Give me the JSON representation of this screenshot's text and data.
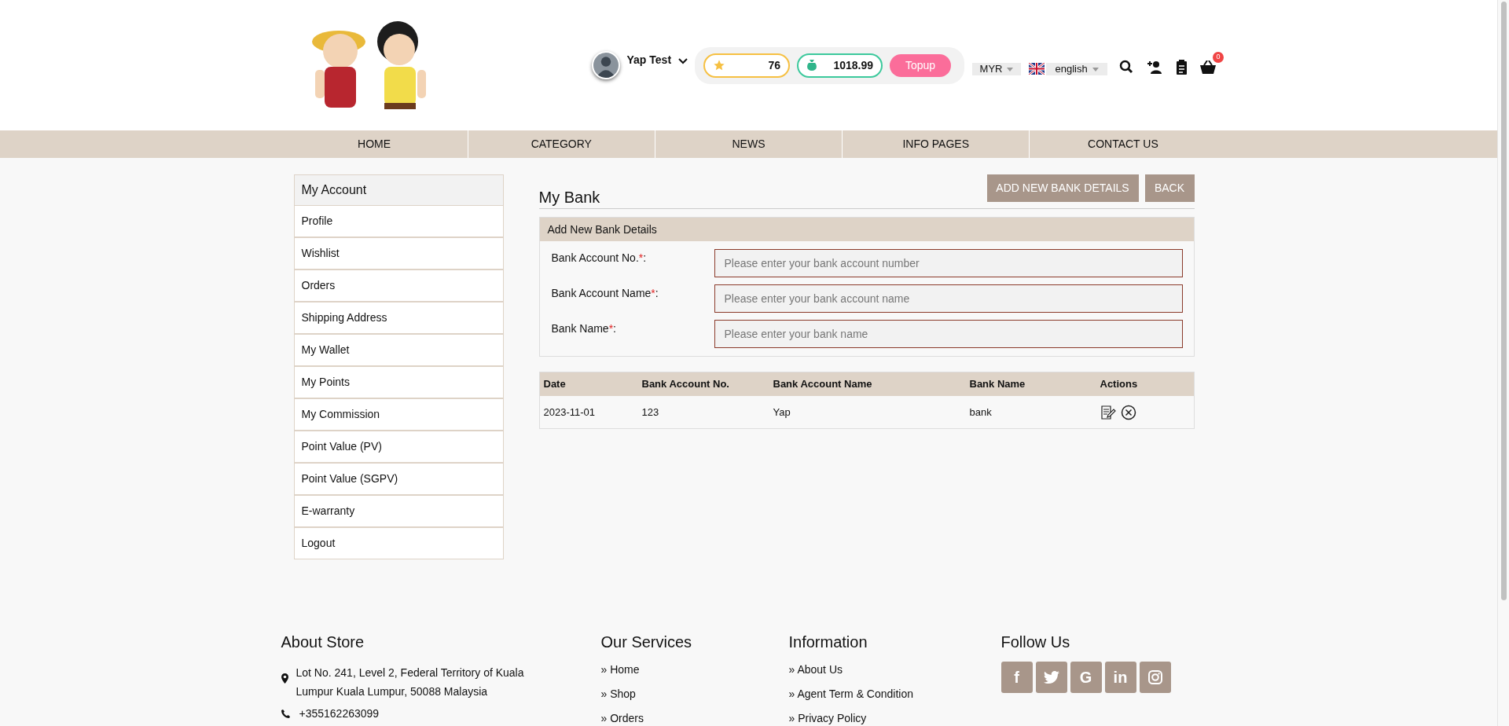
{
  "header": {
    "user_name": "Yap Test",
    "points": "76",
    "wallet": "1018.99",
    "topup_button": "Topup",
    "currency": "MYR",
    "language": "english",
    "cart_count": "0"
  },
  "nav": [
    {
      "label": "HOME"
    },
    {
      "label": "CATEGORY"
    },
    {
      "label": "NEWS"
    },
    {
      "label": "INFO PAGES"
    },
    {
      "label": "CONTACT US"
    }
  ],
  "sidebar": {
    "title": "My Account",
    "items": [
      "Profile",
      "Wishlist",
      "Orders",
      "Shipping Address",
      "My Wallet",
      "My Points",
      "My Commission",
      "Point Value (PV)",
      "Point Value (SGPV)",
      "E-warranty",
      "Logout"
    ]
  },
  "page": {
    "title": "My Bank",
    "buttons": [
      "ADD NEW BANK DETAILS",
      "BACK"
    ]
  },
  "form": {
    "title": "Add New Bank Details",
    "fields": [
      {
        "label": "Bank Account No.",
        "required_mark": "*",
        "suffix": ":",
        "placeholder": "Please enter your bank account number"
      },
      {
        "label": "Bank Account Name",
        "required_mark": "*",
        "suffix": ":",
        "placeholder": "Please enter your bank account name"
      },
      {
        "label": "Bank Name",
        "required_mark": "*",
        "suffix": ":",
        "placeholder": "Please enter your bank name"
      }
    ]
  },
  "table": {
    "columns": [
      "Date",
      "Bank Account No.",
      "Bank Account Name",
      "Bank Name",
      "Actions"
    ],
    "rows": [
      {
        "cells": [
          "2023-11-01",
          "123",
          "Yap",
          "bank"
        ]
      }
    ]
  },
  "footer": {
    "about": {
      "title": "About Store",
      "address": "Lot No. 241, Level 2, Federal Territory of Kuala Lumpur Kuala Lumpur, 50088 Malaysia",
      "phone": "+355162263099"
    },
    "services": {
      "title": "Our Services",
      "links": [
        "» Home",
        "» Shop",
        "» Orders"
      ]
    },
    "information": {
      "title": "Information",
      "links": [
        "» About Us",
        "» Agent Term & Condition",
        "» Privacy Policy"
      ]
    },
    "follow": {
      "title": "Follow Us",
      "icons": [
        {
          "kind": "text",
          "glyph": "f"
        },
        {
          "kind": "bird"
        },
        {
          "kind": "text",
          "glyph": "G"
        },
        {
          "kind": "text",
          "glyph": "in"
        },
        {
          "kind": "camera"
        }
      ]
    }
  }
}
